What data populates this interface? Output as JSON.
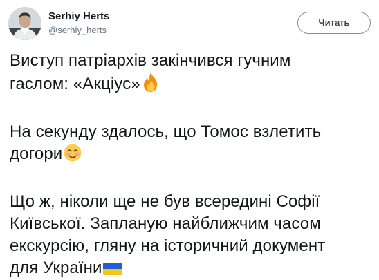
{
  "author": {
    "display_name": "Serhiy Herts",
    "handle": "@serhiy_herts"
  },
  "follow_button": {
    "label": "Читать"
  },
  "tweet": {
    "paragraphs": [
      {
        "lines": [
          "Виступ патріархів закінчився гучним",
          "гаслом: «Акціус»"
        ],
        "emoji": "fire-icon"
      },
      {
        "lines": [
          "На секунду здалось, що Томос взлетить",
          "догори"
        ],
        "emoji": "smiling-face-with-rosy-cheeks-icon"
      },
      {
        "lines": [
          "Що ж, ніколи ще не був всередині Софії",
          "Київської. Запланую найближчим часом",
          "екскурсію, гляну на історичний документ",
          "для України"
        ],
        "emoji": "ukraine-flag-icon"
      }
    ]
  },
  "colors": {
    "text": "#14171a",
    "secondary": "#657786",
    "flag_blue": "#1f5fd1",
    "flag_yellow": "#f5c51c"
  }
}
